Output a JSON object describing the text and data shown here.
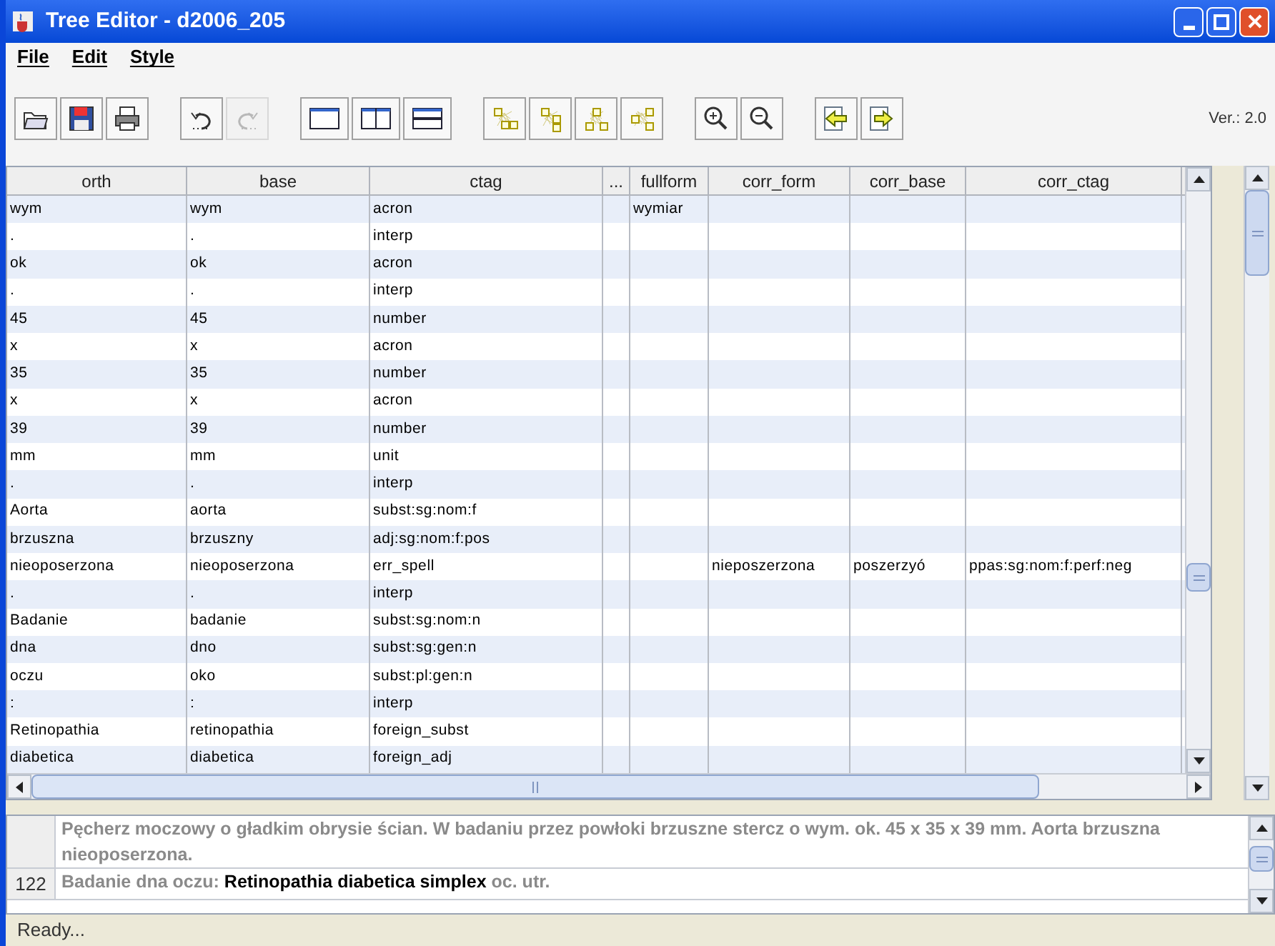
{
  "window": {
    "title": "Tree Editor - d2006_205"
  },
  "menu": [
    "File",
    "Edit",
    "Style"
  ],
  "toolbar": [
    [
      {
        "kind": "open",
        "disabled": false
      },
      {
        "kind": "save",
        "disabled": false
      },
      {
        "kind": "print",
        "disabled": false
      }
    ],
    [
      {
        "kind": "undo",
        "disabled": false
      },
      {
        "kind": "redo",
        "disabled": true
      }
    ],
    [
      {
        "kind": "single",
        "disabled": false
      },
      {
        "kind": "split-vertical",
        "disabled": false
      },
      {
        "kind": "split-horizontal",
        "disabled": false
      }
    ],
    [
      {
        "kind": "tree-a",
        "disabled": false
      },
      {
        "kind": "tree-b",
        "disabled": false
      },
      {
        "kind": "tree-c",
        "disabled": false
      },
      {
        "kind": "tree-d",
        "disabled": false
      }
    ],
    [
      {
        "kind": "zoom-in",
        "disabled": false
      },
      {
        "kind": "zoom-out",
        "disabled": false
      }
    ],
    [
      {
        "kind": "previous",
        "disabled": false
      },
      {
        "kind": "next",
        "disabled": false
      }
    ]
  ],
  "version": "Ver.: 2.0",
  "table": {
    "columns": [
      "orth",
      "base",
      "ctag",
      "...",
      "fullform",
      "corr_form",
      "corr_base",
      "corr_ctag"
    ],
    "rows": [
      [
        "wym",
        "wym",
        "acron",
        "",
        "wymiar",
        "",
        "",
        ""
      ],
      [
        ".",
        ".",
        "interp",
        "",
        "",
        "",
        "",
        ""
      ],
      [
        "ok",
        "ok",
        "acron",
        "",
        "",
        "",
        "",
        ""
      ],
      [
        ".",
        ".",
        "interp",
        "",
        "",
        "",
        "",
        ""
      ],
      [
        "45",
        "45",
        "number",
        "",
        "",
        "",
        "",
        ""
      ],
      [
        "x",
        "x",
        "acron",
        "",
        "",
        "",
        "",
        ""
      ],
      [
        "35",
        "35",
        "number",
        "",
        "",
        "",
        "",
        ""
      ],
      [
        "x",
        "x",
        "acron",
        "",
        "",
        "",
        "",
        ""
      ],
      [
        "39",
        "39",
        "number",
        "",
        "",
        "",
        "",
        ""
      ],
      [
        "mm",
        "mm",
        "unit",
        "",
        "",
        "",
        "",
        ""
      ],
      [
        ".",
        ".",
        "interp",
        "",
        "",
        "",
        "",
        ""
      ],
      [
        "Aorta",
        "aorta",
        "subst:sg:nom:f",
        "",
        "",
        "",
        "",
        ""
      ],
      [
        "brzuszna",
        "brzuszny",
        "adj:sg:nom:f:pos",
        "",
        "",
        "",
        "",
        ""
      ],
      [
        "nieoposerzona",
        "nieoposerzona",
        "err_spell",
        "",
        "",
        "nieposzerzona",
        "poszerzyó",
        "ppas:sg:nom:f:perf:neg"
      ],
      [
        ".",
        ".",
        "interp",
        "",
        "",
        "",
        "",
        ""
      ],
      [
        "Badanie",
        "badanie",
        "subst:sg:nom:n",
        "",
        "",
        "",
        "",
        ""
      ],
      [
        "dna",
        "dno",
        "subst:sg:gen:n",
        "",
        "",
        "",
        "",
        ""
      ],
      [
        "oczu",
        "oko",
        "subst:pl:gen:n",
        "",
        "",
        "",
        "",
        ""
      ],
      [
        ":",
        ":",
        "interp",
        "",
        "",
        "",
        "",
        ""
      ],
      [
        "Retinopathia",
        "retinopathia",
        "foreign_subst",
        "",
        "",
        "",
        "",
        ""
      ],
      [
        "diabetica",
        "diabetica",
        "foreign_adj",
        "",
        "",
        "",
        "",
        ""
      ]
    ]
  },
  "text_lines": [
    {
      "segments": [
        {
          "text": "Pęcherz moczowy o gładkim obrysie ścian. W badaniu przez powłoki brzuszne stercz o wym. ok. 45 x 35 x 39 mm. Aorta brzuszna nieoposerzona.",
          "highlight": false
        }
      ]
    },
    {
      "number": "122",
      "segments": [
        {
          "text": "Badanie dna oczu:",
          "highlight": false
        },
        {
          "text": "Retinopathia diabetica simplex",
          "highlight": true
        },
        {
          "text": "oc. utr.",
          "highlight": false
        }
      ]
    }
  ],
  "status_bar": "Ready..."
}
